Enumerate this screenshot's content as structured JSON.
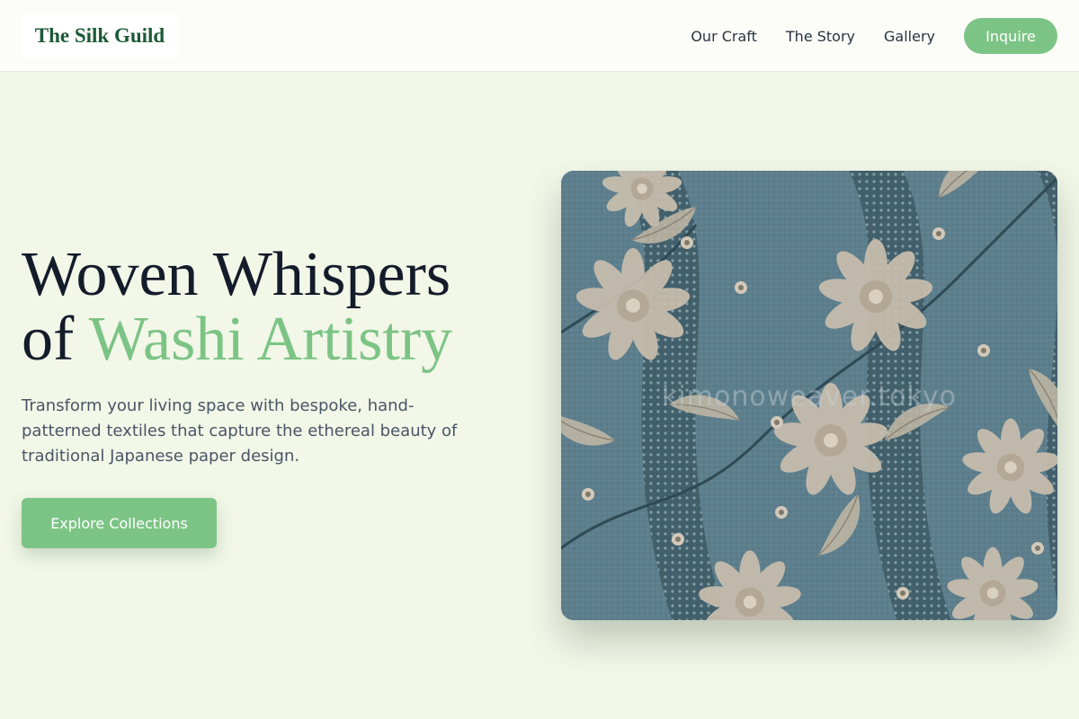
{
  "header": {
    "brand": "The Silk Guild",
    "nav": [
      "Our Craft",
      "The Story",
      "Gallery"
    ],
    "cta_label": "Inquire"
  },
  "hero": {
    "title_line1": "Woven Whispers",
    "title_line2_prefix": "of",
    "title_line2_accent": "Washi Artistry",
    "subtitle": "Transform your living space with bespoke, hand-patterned textiles that capture the ethereal beauty of traditional Japanese paper design.",
    "cta_label": "Explore Collections",
    "image": {
      "watermark": "kimonoweaver.tokyo",
      "icon": "floral-textile-image"
    }
  },
  "colors": {
    "background": "#f2f7e8",
    "header_bg": "#fcfdf9",
    "brand": "#1c5a37",
    "accent": "#7cc485",
    "heading": "#141c2b",
    "body_text": "#4a5566",
    "fabric": "#5b7c8a"
  }
}
